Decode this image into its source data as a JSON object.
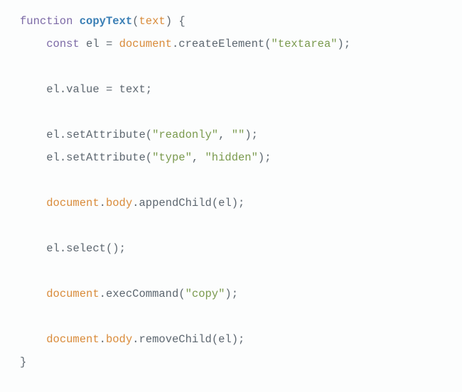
{
  "tokens": {
    "kw_function": "function",
    "fn_name": "copyText",
    "paren_open": "(",
    "param_text": "text",
    "paren_close": ")",
    "space": " ",
    "brace_open": "{",
    "kw_const": "const",
    "id_el": "el",
    "eq": " = ",
    "obj_document": "document",
    "dot": ".",
    "m_createElement": "createElement",
    "str_textarea": "\"textarea\"",
    "semi": ";",
    "prop_value": "value",
    "id_text": "text",
    "m_setAttribute": "setAttribute",
    "str_readonly": "\"readonly\"",
    "str_empty": "\"\"",
    "str_type": "\"type\"",
    "str_hidden": "\"hidden\"",
    "prop_body": "body",
    "m_appendChild": "appendChild",
    "m_select": "select",
    "m_execCommand": "execCommand",
    "str_copy": "\"copy\"",
    "m_removeChild": "removeChild",
    "brace_close": "}",
    "comma_sp": ", ",
    "indent": "    "
  }
}
